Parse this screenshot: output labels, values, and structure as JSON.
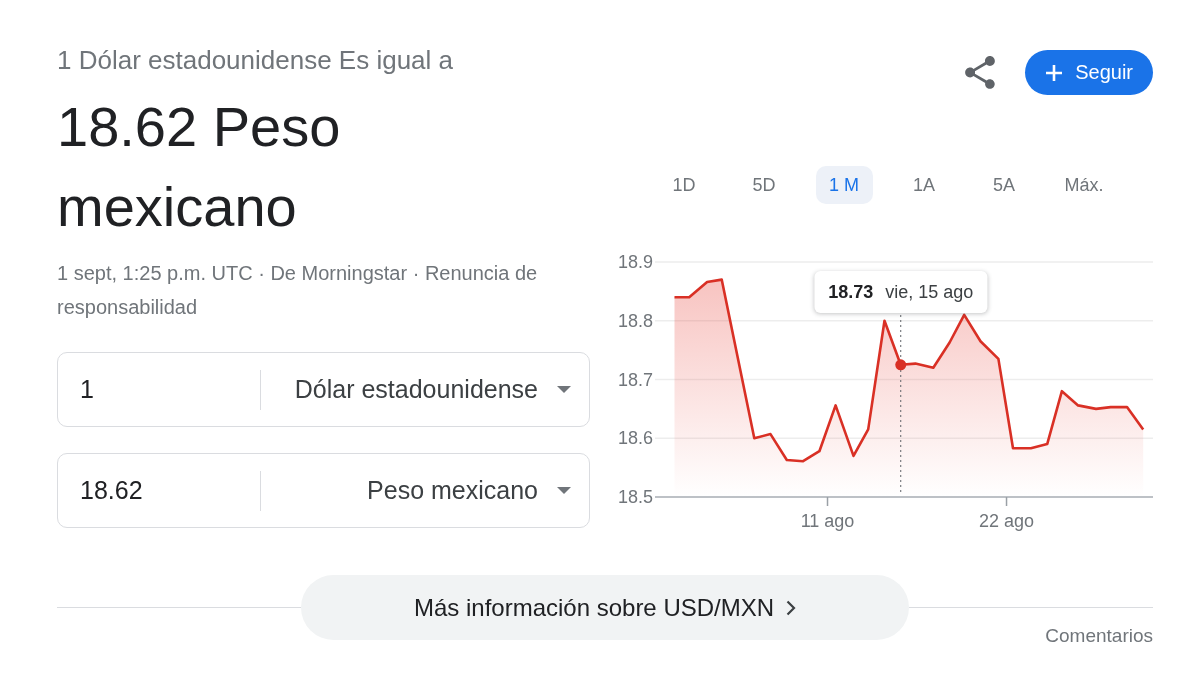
{
  "header": {
    "equation": "1 Dólar estadounidense Es igual a",
    "result": "18.62 Peso mexicano",
    "source_line": "1 sept, 1:25 p.m. UTC · De Morningstar · Renuncia de responsabilidad"
  },
  "actions": {
    "follow_button": "Seguir"
  },
  "converter": [
    {
      "amount": "1",
      "currency": "Dólar estadounidense"
    },
    {
      "amount": "18.62",
      "currency": "Peso mexicano"
    }
  ],
  "range_tabs": [
    {
      "label": "1D",
      "selected": false
    },
    {
      "label": "5D",
      "selected": false
    },
    {
      "label": "1 M",
      "selected": true
    },
    {
      "label": "1A",
      "selected": false
    },
    {
      "label": "5A",
      "selected": false
    },
    {
      "label": "Máx.",
      "selected": false
    }
  ],
  "chart": {
    "tooltip": {
      "value": "18.73",
      "date": "vie, 15 ago"
    },
    "chart_data": {
      "type": "area",
      "x": [
        1.6,
        2.5,
        3.6,
        4.5,
        6.5,
        7.5,
        8.5,
        9.5,
        10.5,
        11.5,
        12.6,
        13.5,
        14.5,
        15.5,
        16.4,
        17.5,
        18.5,
        19.4,
        20.4,
        21.5,
        22.4,
        23.5,
        24.5,
        25.4,
        26.4,
        27.5,
        28.4,
        29.4,
        30.4
      ],
      "values": [
        18.84,
        18.84,
        18.866,
        18.87,
        18.6,
        18.607,
        18.563,
        18.561,
        18.578,
        18.656,
        18.57,
        18.615,
        18.8,
        18.725,
        18.727,
        18.72,
        18.763,
        18.81,
        18.765,
        18.735,
        18.583,
        18.583,
        18.59,
        18.68,
        18.656,
        18.65,
        18.653,
        18.653,
        18.615
      ],
      "xlim": [
        0.4,
        31
      ],
      "ylim": [
        18.5,
        18.9
      ],
      "xticks": [
        {
          "value": 11,
          "label": "11 ago"
        },
        {
          "value": 22,
          "label": "22 ago"
        }
      ],
      "yticks": [
        18.5,
        18.6,
        18.7,
        18.8,
        18.9
      ],
      "grid": true,
      "ref_lines": [
        {
          "axis": "x",
          "value": 15.5
        }
      ]
    }
  },
  "more_info_button": "Más información sobre USD/MXN",
  "feedback_link": "Comentarios"
}
